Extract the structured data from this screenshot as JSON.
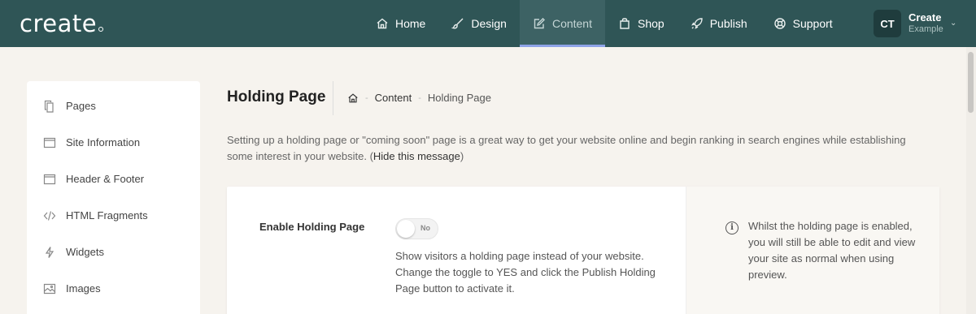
{
  "app": {
    "logo_text": "create"
  },
  "nav": {
    "items": [
      {
        "label": "Home",
        "icon": "home-icon"
      },
      {
        "label": "Design",
        "icon": "brush-icon"
      },
      {
        "label": "Content",
        "icon": "edit-icon",
        "active": true
      },
      {
        "label": "Shop",
        "icon": "bag-icon"
      },
      {
        "label": "Publish",
        "icon": "rocket-icon"
      },
      {
        "label": "Support",
        "icon": "lifebuoy-icon"
      }
    ]
  },
  "user": {
    "initials": "CT",
    "name": "Create",
    "subtitle": "Example"
  },
  "sidebar": {
    "items": [
      {
        "label": "Pages",
        "icon": "pages-icon"
      },
      {
        "label": "Site Information",
        "icon": "window-icon"
      },
      {
        "label": "Header & Footer",
        "icon": "window-icon"
      },
      {
        "label": "HTML Fragments",
        "icon": "code-icon"
      },
      {
        "label": "Widgets",
        "icon": "bolt-icon"
      },
      {
        "label": "Images",
        "icon": "image-icon"
      }
    ]
  },
  "page": {
    "title": "Holding Page",
    "breadcrumb": {
      "section": "Content",
      "current": "Holding Page"
    },
    "intro": "Setting up a holding page or \"coming soon\" page is a great way to get your website online and begin ranking in search engines while establishing some interest in your website. (",
    "hide_link": "Hide this message",
    "intro_end": ")"
  },
  "form": {
    "enable_label": "Enable Holding Page",
    "toggle_value": "No",
    "help_text": "Show visitors a holding page instead of your website. Change the toggle to YES and click the Publish Holding Page button to activate it.",
    "info_text": "Whilst the holding page is enabled, you will still be able to edit and view your site as normal when using preview."
  },
  "colors": {
    "topbar": "#2f5556",
    "active_underline": "#8ea3e7",
    "background": "#f6f3ee"
  }
}
